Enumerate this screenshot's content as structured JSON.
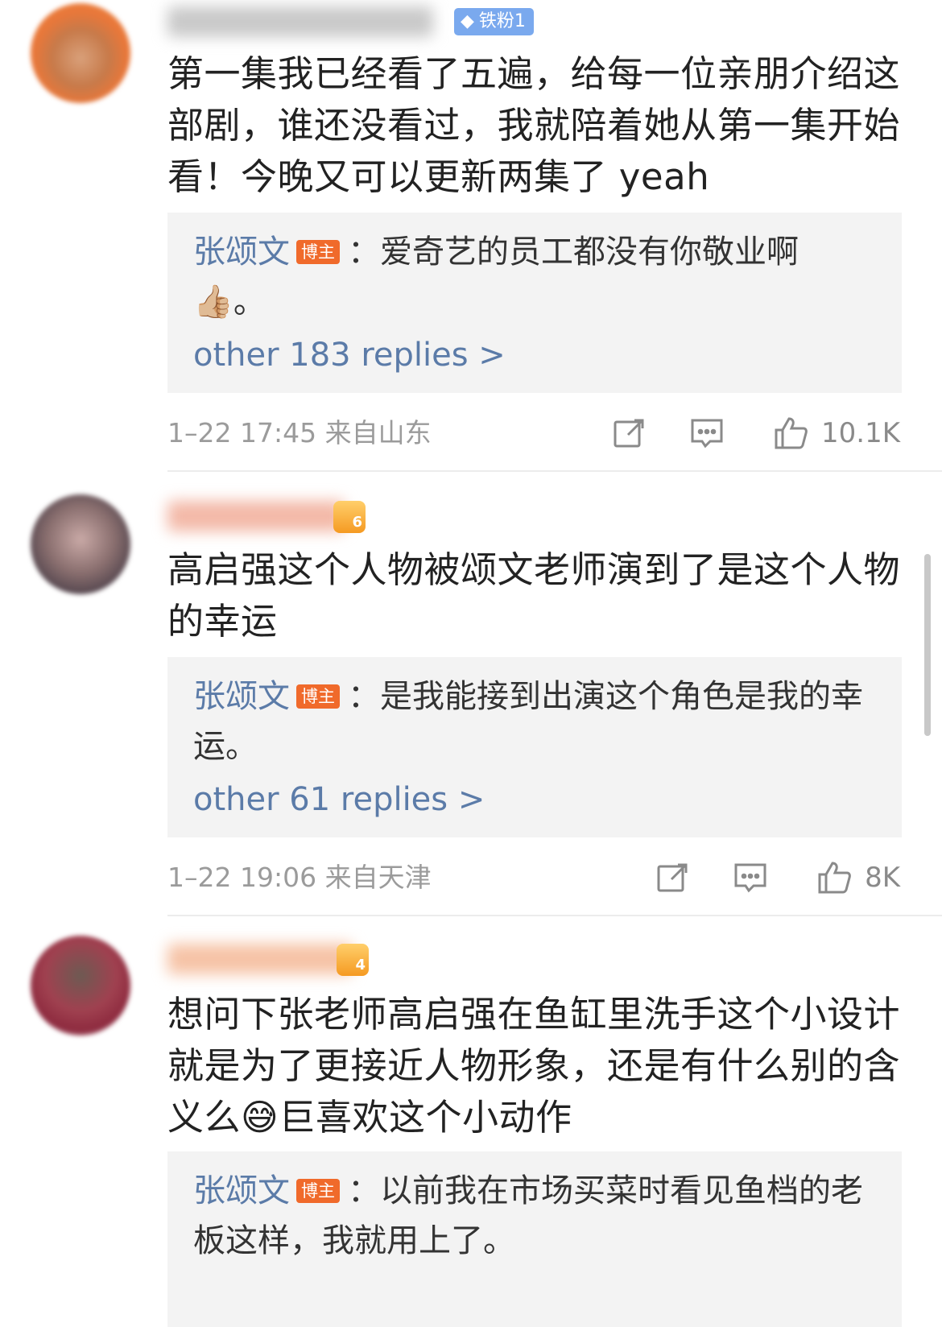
{
  "comments": [
    {
      "fan_badge": "铁粉1",
      "text": "第一集我已经看了五遍，给每一位亲朋介绍这部剧，谁还没看过，我就陪着她从第一集开始看！今晚又可以更新两集了 yeah",
      "reply": {
        "author": "张颂文",
        "badge": "博主",
        "text": "：爱奇艺的员工都没有你敬业啊",
        "emoji": "👍🏼",
        "tail": "。",
        "more": "other 183 replies >"
      },
      "timestamp": "1–22 17:45  来自山东",
      "likes": "10.1K"
    },
    {
      "level": "6",
      "text": "高启强这个人物被颂文老师演到了是这个人物的幸运",
      "reply": {
        "author": "张颂文",
        "badge": "博主",
        "text": "：是我能接到出演这个角色是我的幸运。",
        "more": "other 61 replies >"
      },
      "timestamp": "1–22 19:06  来自天津",
      "likes": "8K"
    },
    {
      "level": "4",
      "text_before": "想问下张老师高启强在鱼缸里洗手这个小设计就是为了更接近人物形象，还是有什么别的含义么",
      "emoji": "😅",
      "text_after": "巨喜欢这个小动作",
      "reply": {
        "author": "张颂文",
        "badge": "博主",
        "text": "：以前我在市场买菜时看见鱼档的老板这样，我就用上了。"
      }
    }
  ],
  "icons": [
    "share-icon",
    "comment-icon",
    "like-icon"
  ],
  "colors": {
    "link": "#5b7ba8",
    "author_badge": "#f06a2b",
    "fan_badge": "#7aa9ee",
    "meta": "#9b9b9b"
  }
}
